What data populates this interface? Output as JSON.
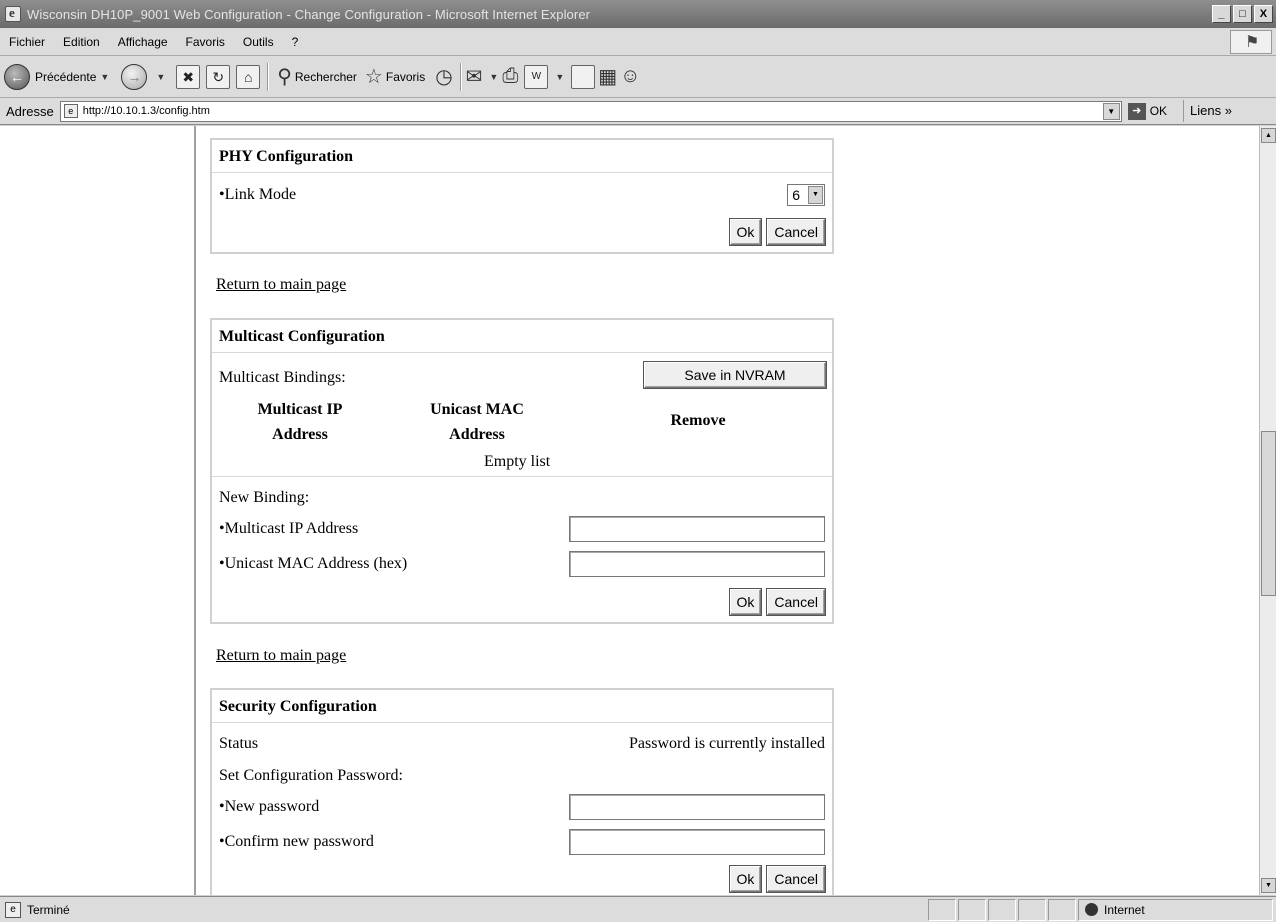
{
  "window": {
    "title": "Wisconsin DH10P_9001 Web Configuration - Change Configuration - Microsoft Internet Explorer",
    "controls": {
      "minimize": "_",
      "maximize": "□",
      "close": "X"
    }
  },
  "menu": [
    "Fichier",
    "Edition",
    "Affichage",
    "Favoris",
    "Outils",
    "?"
  ],
  "toolbar": {
    "back_label": "Précédente",
    "search_label": "Rechercher",
    "favorites_label": "Favoris"
  },
  "address": {
    "label": "Adresse",
    "url": "http://10.10.1.3/config.htm",
    "go_label": "OK",
    "links_label": "Liens »"
  },
  "phy": {
    "title": "PHY Configuration",
    "link_mode_label": "•Link Mode",
    "link_mode_value": "6",
    "ok_label": "Ok",
    "cancel_label": "Cancel"
  },
  "return_link_1": "Return to main page",
  "multicast": {
    "title": "Multicast Configuration",
    "bindings_label": "Multicast Bindings:",
    "save_label": "Save in NVRAM",
    "columns": [
      "Multicast IP Address",
      "Unicast MAC Address",
      "Remove"
    ],
    "empty_text": "Empty list",
    "new_binding_label": "New Binding:",
    "ip_label": "•Multicast IP Address",
    "mac_label": "•Unicast MAC Address (hex)",
    "ip_value": "",
    "mac_value": "",
    "ok_label": "Ok",
    "cancel_label": "Cancel"
  },
  "return_link_2": "Return to main page",
  "security": {
    "title": "Security Configuration",
    "status_label": "Status",
    "status_value": "Password is currently installed",
    "set_label": "Set Configuration Password:",
    "new_label": "•New password",
    "confirm_label": "•Confirm new password",
    "new_value": "",
    "confirm_value": "",
    "ok_label": "Ok",
    "cancel_label": "Cancel"
  },
  "status": {
    "text": "Terminé",
    "zone": "Internet"
  }
}
